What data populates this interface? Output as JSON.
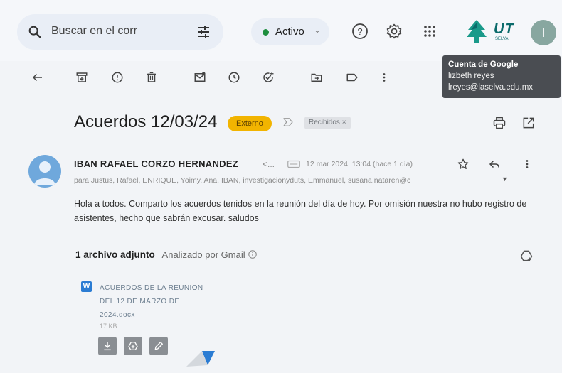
{
  "search": {
    "placeholder": "Buscar en el corr"
  },
  "status": {
    "label": "Activo"
  },
  "logo": {
    "text": "UT",
    "subtext": "SELVA"
  },
  "account": {
    "initial": "I",
    "tooltip_title": "Cuenta de Google",
    "tooltip_name": "lizbeth reyes",
    "tooltip_email": "lreyes@laselva.edu.mx"
  },
  "email": {
    "subject": "Acuerdos 12/03/24",
    "badge": "Externo",
    "label_chip": "Recibidos ×",
    "sender_name": "IBAN RAFAEL CORZO HERNANDEZ",
    "sender_email_truncated": "<...",
    "date": "12 mar 2024, 13:04 (hace 1 día)",
    "recipients": "para Justus, Rafael, ENRIQUE, Yoimy, Ana, IBAN, investigacionyduts, Emmanuel, susana.nataren@c",
    "body": "Hola a todos. Comparto los acuerdos tenidos en la reunión del día de hoy. Por omisión nuestra no hubo registro de asistentes, hecho que sabrán excusar. saludos"
  },
  "attachments": {
    "count_label": "1 archivo adjunto",
    "scan_label": "Analizado por Gmail",
    "file": {
      "type_letter": "W",
      "name": "ACUERDOS DE LA REUNION DEL 12 DE MARZO DE 2024.docx",
      "size": "17 KB"
    }
  },
  "icons": {
    "accent_yellow": "#f2b400",
    "word_blue": "#2b7cd3",
    "active_green": "#1e8e3e"
  }
}
